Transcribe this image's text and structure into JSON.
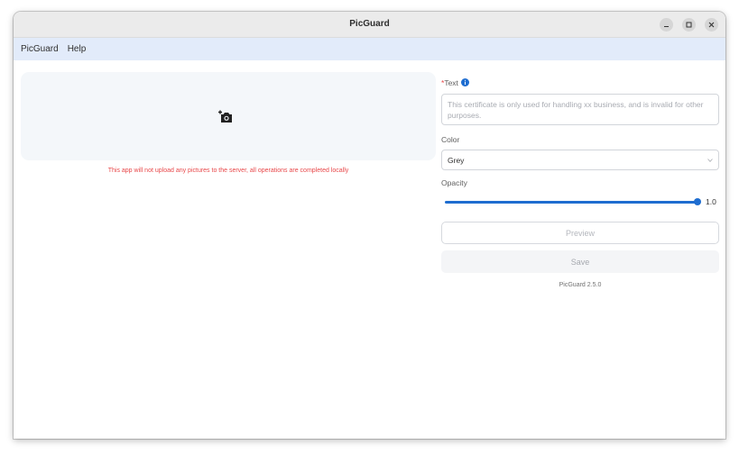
{
  "window": {
    "title": "PicGuard",
    "controls": {
      "minimize": "minimize-icon",
      "maximize": "maximize-icon",
      "close": "close-icon"
    }
  },
  "menubar": {
    "items": [
      {
        "label": "PicGuard"
      },
      {
        "label": "Help"
      }
    ]
  },
  "upload": {
    "icon": "add-photo-icon",
    "notice": "This app will not upload any pictures to the server, all operations are completed locally"
  },
  "form": {
    "text_required_marker": "*",
    "text_label": "Text",
    "text_info_icon": "info-icon",
    "text_placeholder": "This certificate is only used for handling xx business, and is invalid for other purposes.",
    "color_label": "Color",
    "color_value": "Grey",
    "opacity_label": "Opacity",
    "opacity_value": "1.0",
    "opacity_level": 1.0,
    "preview_label": "Preview",
    "save_label": "Save"
  },
  "footer": {
    "version": "PicGuard 2.5.0"
  },
  "colors": {
    "accent": "#1e6dd0",
    "notice": "#e8484a",
    "menubar_bg": "#e2ebfa"
  }
}
